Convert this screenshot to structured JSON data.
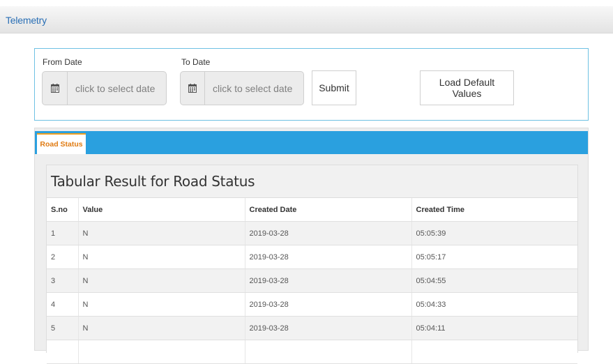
{
  "header": {
    "title": "Telemetry"
  },
  "filters": {
    "from_label": "From Date",
    "from_placeholder": "click to select date",
    "to_label": "To Date",
    "to_placeholder": "click to select date",
    "submit_label": "Submit",
    "load_default_label": "Load Default Values"
  },
  "tabs": [
    {
      "label": "Road Status",
      "active": true
    }
  ],
  "result": {
    "title": "Tabular Result for Road Status",
    "columns": [
      "S.no",
      "Value",
      "Created Date",
      "Created Time"
    ],
    "rows": [
      {
        "sno": "1",
        "value": "N",
        "date": "2019-03-28",
        "time": "05:05:39"
      },
      {
        "sno": "2",
        "value": "N",
        "date": "2019-03-28",
        "time": "05:05:17"
      },
      {
        "sno": "3",
        "value": "N",
        "date": "2019-03-28",
        "time": "05:04:55"
      },
      {
        "sno": "4",
        "value": "N",
        "date": "2019-03-28",
        "time": "05:04:33"
      },
      {
        "sno": "5",
        "value": "N",
        "date": "2019-03-28",
        "time": "05:04:11"
      },
      {
        "sno": "",
        "value": "",
        "date": "",
        "time": ""
      }
    ]
  },
  "colors": {
    "accent": "#2aa0df",
    "tab_text": "#e07b12",
    "title_link": "#2a6fb5",
    "panel_border": "#6fc1e3"
  },
  "icons": {
    "date_addon": "calendar-icon"
  }
}
